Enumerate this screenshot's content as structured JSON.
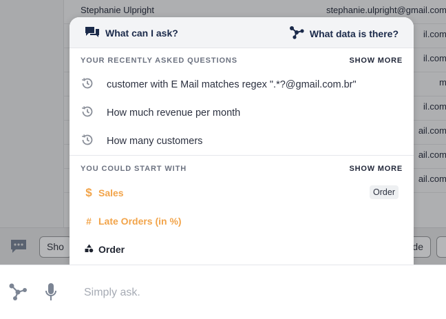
{
  "background": {
    "rows": [
      {
        "name": "Stephanie Ulpright",
        "email": "stephanie.ulpright@gmail.com"
      },
      {
        "name": "",
        "email": "il.com"
      },
      {
        "name": "",
        "email": "il.com"
      },
      {
        "name": "",
        "email": "m"
      },
      {
        "name": "",
        "email": "il.com"
      },
      {
        "name": "",
        "email": "ail.com"
      },
      {
        "name": "",
        "email": "ail.com"
      },
      {
        "name": "",
        "email": "ail.com"
      }
    ],
    "buttons": [
      "Sho",
      "de",
      ""
    ]
  },
  "popup": {
    "what_can_i_ask": "What can I ask?",
    "what_data": "What data is there?",
    "recent_title": "YOUR RECENTLY ASKED QUESTIONS",
    "recent_show_more": "SHOW MORE",
    "recent": [
      "customer with E Mail matches regex \".*?@gmail.com.br\"",
      "How much revenue per month",
      "How many customers"
    ],
    "suggest_title": "YOU COULD START WITH",
    "suggest_show_more": "SHOW MORE",
    "suggestions": [
      {
        "glyph": "$",
        "label": "Sales",
        "color": "#f2a44a"
      },
      {
        "glyph": "#",
        "label": "Late Orders (in %)",
        "color": "#f2a44a"
      },
      {
        "glyph": "",
        "label": "Order",
        "color": "#1f2430"
      }
    ],
    "tag": "Order"
  },
  "input": {
    "placeholder": "Simply ask."
  },
  "colors": {
    "accent": "#f2a44a",
    "navy": "#1b2a4a"
  }
}
